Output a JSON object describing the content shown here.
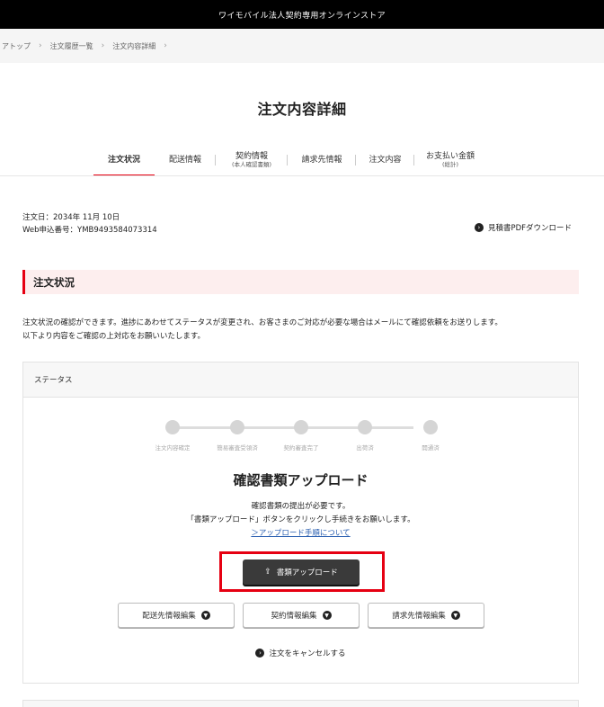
{
  "topbar": {
    "title": "ワイモバイル法人契約専用オンラインストア"
  },
  "breadcrumb": [
    "アトップ",
    "注文履歴一覧",
    "注文内容詳細"
  ],
  "page": {
    "title": "注文内容詳細"
  },
  "tabs": [
    {
      "label": "注文状況",
      "sub": "",
      "active": true
    },
    {
      "label": "配送情報",
      "sub": ""
    },
    {
      "label": "契約情報",
      "sub": "(本人確認書類)"
    },
    {
      "label": "請求先情報",
      "sub": ""
    },
    {
      "label": "注文内容",
      "sub": ""
    },
    {
      "label": "お支払い金額",
      "sub": "(総計)"
    }
  ],
  "order": {
    "date_line": "注文日：2034年 11月 10日",
    "number_line": "Web申込番号：YMB9493584073314",
    "pdf_label": "見積書PDFダウンロード"
  },
  "section": {
    "title": "注文状況",
    "desc1": "注文状況の確認ができます。進捗にあわせてステータスが変更され、お客さまのご対応が必要な場合はメールにて確認依頼をお送りします。",
    "desc2": "以下より内容をご確認の上対応をお願いいたします。"
  },
  "status": {
    "header": "ステータス",
    "steps": [
      "注文内容確定",
      "簡易審査受領済",
      "契約審査完了",
      "出荷済",
      "開通済"
    ]
  },
  "upload": {
    "title": "確認書類アップロード",
    "msg1": "確認書類の提出が必要です。",
    "msg2": "「書類アップロード」ボタンをクリックし手続きをお願いします。",
    "link": "＞アップロード手順について",
    "button": "書類アップロード"
  },
  "edit_buttons": [
    "配送先情報編集",
    "契約情報編集",
    "請求先情報編集"
  ],
  "cancel": {
    "label": "注文をキャンセルする"
  },
  "colors": {
    "accent": "#e60012",
    "dark": "#3a3a3a"
  }
}
